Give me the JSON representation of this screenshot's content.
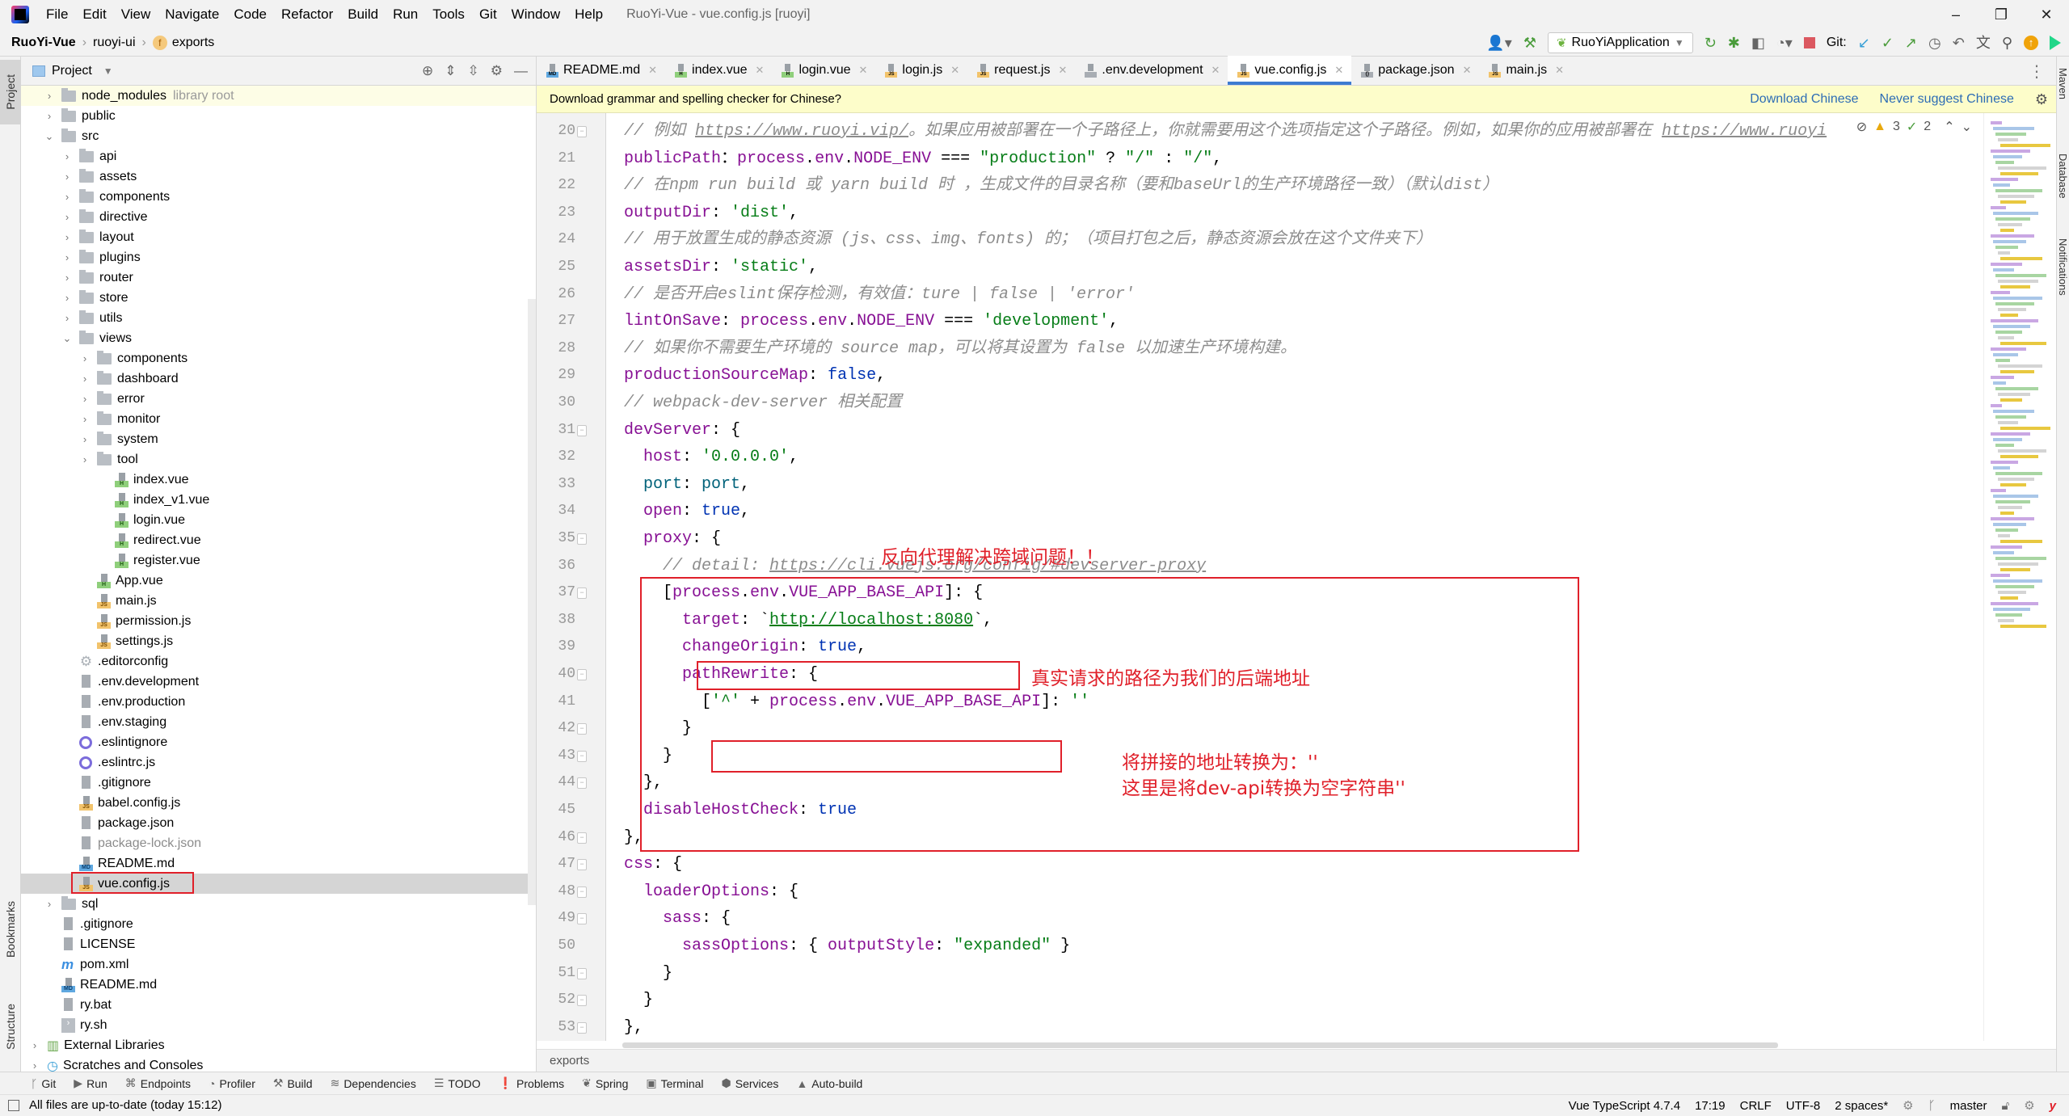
{
  "window": {
    "title": "RuoYi-Vue - vue.config.js [ruoyi]",
    "menu": [
      "File",
      "Edit",
      "View",
      "Navigate",
      "Code",
      "Refactor",
      "Build",
      "Run",
      "Tools",
      "Git",
      "Window",
      "Help"
    ],
    "controls": {
      "minimize": "–",
      "restore": "❐",
      "close": "✕"
    }
  },
  "breadcrumb": {
    "project": "RuoYi-Vue",
    "module": "ruoyi-ui",
    "symbol_badge": "f",
    "symbol": "exports"
  },
  "toolbar": {
    "run_config": "RuoYiApplication",
    "git_label": "Git:",
    "icons": [
      "user-icon",
      "build-hammer-icon",
      "rerun-icon",
      "debug-icon",
      "coverage-icon",
      "profile-icon",
      "stop-icon",
      "git-update-icon",
      "git-commit-icon",
      "git-push-icon",
      "history-icon",
      "rollback-icon",
      "translate-icon",
      "search-icon",
      "update-icon",
      "plugin-icon"
    ]
  },
  "colors": {
    "accent": "#3d7bd1",
    "annotation_red": "#e0202a",
    "keyword": "#871094",
    "string": "#067d17",
    "literal": "#0033b3",
    "comment": "#8c8c8c",
    "notice_bg": "#fdfdca"
  },
  "left_strip": {
    "project": "Project",
    "bookmarks": "Bookmarks",
    "structure": "Structure"
  },
  "right_strip": {
    "maven": "Maven",
    "database": "Database",
    "notifications": "Notifications"
  },
  "project_panel": {
    "title": "Project",
    "tree": [
      {
        "label": "node_modules",
        "suffix": "library root",
        "type": "folder",
        "depth": 2,
        "arrow": "›",
        "libroot": true
      },
      {
        "label": "public",
        "type": "folder",
        "depth": 2,
        "arrow": "›"
      },
      {
        "label": "src",
        "type": "folder",
        "depth": 2,
        "arrow": "⌄"
      },
      {
        "label": "api",
        "type": "folder",
        "depth": 3,
        "arrow": "›"
      },
      {
        "label": "assets",
        "type": "folder",
        "depth": 3,
        "arrow": "›"
      },
      {
        "label": "components",
        "type": "folder",
        "depth": 3,
        "arrow": "›"
      },
      {
        "label": "directive",
        "type": "folder",
        "depth": 3,
        "arrow": "›"
      },
      {
        "label": "layout",
        "type": "folder",
        "depth": 3,
        "arrow": "›"
      },
      {
        "label": "plugins",
        "type": "folder",
        "depth": 3,
        "arrow": "›"
      },
      {
        "label": "router",
        "type": "folder",
        "depth": 3,
        "arrow": "›"
      },
      {
        "label": "store",
        "type": "folder",
        "depth": 3,
        "arrow": "›"
      },
      {
        "label": "utils",
        "type": "folder",
        "depth": 3,
        "arrow": "›"
      },
      {
        "label": "views",
        "type": "folder",
        "depth": 3,
        "arrow": "⌄"
      },
      {
        "label": "components",
        "type": "folder",
        "depth": 4,
        "arrow": "›"
      },
      {
        "label": "dashboard",
        "type": "folder",
        "depth": 4,
        "arrow": "›"
      },
      {
        "label": "error",
        "type": "folder",
        "depth": 4,
        "arrow": "›"
      },
      {
        "label": "monitor",
        "type": "folder",
        "depth": 4,
        "arrow": "›"
      },
      {
        "label": "system",
        "type": "folder",
        "depth": 4,
        "arrow": "›"
      },
      {
        "label": "tool",
        "type": "folder",
        "depth": 4,
        "arrow": "›"
      },
      {
        "label": "index.vue",
        "type": "vue",
        "depth": 5
      },
      {
        "label": "index_v1.vue",
        "type": "vue",
        "depth": 5
      },
      {
        "label": "login.vue",
        "type": "vue",
        "depth": 5
      },
      {
        "label": "redirect.vue",
        "type": "vue",
        "depth": 5
      },
      {
        "label": "register.vue",
        "type": "vue",
        "depth": 5
      },
      {
        "label": "App.vue",
        "type": "vue",
        "depth": 4
      },
      {
        "label": "main.js",
        "type": "js",
        "depth": 4
      },
      {
        "label": "permission.js",
        "type": "js",
        "depth": 4
      },
      {
        "label": "settings.js",
        "type": "js",
        "depth": 4
      },
      {
        "label": ".editorconfig",
        "type": "gear",
        "depth": 3
      },
      {
        "label": ".env.development",
        "type": "txt",
        "depth": 3
      },
      {
        "label": ".env.production",
        "type": "txt",
        "depth": 3
      },
      {
        "label": ".env.staging",
        "type": "txt",
        "depth": 3
      },
      {
        "label": ".eslintignore",
        "type": "eslint",
        "depth": 3
      },
      {
        "label": ".eslintrc.js",
        "type": "eslint",
        "depth": 3
      },
      {
        "label": ".gitignore",
        "type": "ignore",
        "depth": 3
      },
      {
        "label": "babel.config.js",
        "type": "js",
        "depth": 3
      },
      {
        "label": "package.json",
        "type": "json",
        "depth": 3
      },
      {
        "label": "package-lock.json",
        "type": "json",
        "depth": 3,
        "dim": true
      },
      {
        "label": "README.md",
        "type": "md",
        "depth": 3
      },
      {
        "label": "vue.config.js",
        "type": "js",
        "depth": 3,
        "selected": true
      },
      {
        "label": "sql",
        "type": "folder",
        "depth": 2,
        "arrow": "›"
      },
      {
        "label": ".gitignore",
        "type": "ignore",
        "depth": 2
      },
      {
        "label": "LICENSE",
        "type": "txt",
        "depth": 2
      },
      {
        "label": "pom.xml",
        "type": "maven",
        "depth": 2
      },
      {
        "label": "README.md",
        "type": "md",
        "depth": 2
      },
      {
        "label": "ry.bat",
        "type": "bat",
        "depth": 2
      },
      {
        "label": "ry.sh",
        "type": "sh",
        "depth": 2
      },
      {
        "label": "External Libraries",
        "type": "libs",
        "depth": 1,
        "arrow": "›"
      },
      {
        "label": "Scratches and Consoles",
        "type": "scratch",
        "depth": 1,
        "arrow": "›"
      }
    ]
  },
  "editor": {
    "tabs": [
      {
        "label": "README.md",
        "type": "md"
      },
      {
        "label": "index.vue",
        "type": "vue"
      },
      {
        "label": "login.vue",
        "type": "vue"
      },
      {
        "label": "login.js",
        "type": "js"
      },
      {
        "label": "request.js",
        "type": "js"
      },
      {
        "label": ".env.development",
        "type": "txt"
      },
      {
        "label": "vue.config.js",
        "type": "js",
        "active": true
      },
      {
        "label": "package.json",
        "type": "json"
      },
      {
        "label": "main.js",
        "type": "js"
      }
    ],
    "notice": {
      "text": "Download grammar and spelling checker for Chinese?",
      "download": "Download Chinese",
      "never": "Never suggest Chinese"
    },
    "inspections": {
      "warnings": "3",
      "weak_warnings": "2"
    },
    "lines": [
      {
        "n": "20",
        "indent": 0,
        "tokens": [
          [
            "cm",
            "// 例如 "
          ],
          [
            "cm lnk",
            "https://www.ruoyi.vip/"
          ],
          [
            "cm",
            "。如果应用被部署在一个子路径上，你就需要用这个选项指定这个子路径。例如，如果你的应用被部署在 "
          ],
          [
            "cm lnk",
            "https://www.ruoyi"
          ]
        ]
      },
      {
        "n": "21",
        "indent": 0,
        "tokens": [
          [
            "kw",
            "publicPath"
          ],
          [
            "",
            "："
          ],
          [
            "kw",
            "process"
          ],
          [
            "",
            "."
          ],
          [
            "kw",
            "env"
          ],
          [
            "",
            "."
          ],
          [
            "kw",
            "NODE_ENV"
          ],
          [
            "",
            " === "
          ],
          [
            "str",
            "\"production\""
          ],
          [
            "",
            " ? "
          ],
          [
            "str",
            "\"/\""
          ],
          [
            "",
            " : "
          ],
          [
            "str",
            "\"/\""
          ],
          [
            "",
            ","
          ]
        ]
      },
      {
        "n": "22",
        "indent": 0,
        "tokens": [
          [
            "cm",
            "// 在npm run build 或 yarn build 时 ，生成文件的目录名称（要和baseUrl的生产环境路径一致）（默认dist）"
          ]
        ]
      },
      {
        "n": "23",
        "indent": 0,
        "tokens": [
          [
            "kw",
            "outputDir"
          ],
          [
            "",
            ": "
          ],
          [
            "str",
            "'dist'"
          ],
          [
            "",
            ","
          ]
        ]
      },
      {
        "n": "24",
        "indent": 0,
        "tokens": [
          [
            "cm",
            "// 用于放置生成的静态资源 (js、css、img、fonts) 的；（项目打包之后，静态资源会放在这个文件夹下）"
          ]
        ]
      },
      {
        "n": "25",
        "indent": 0,
        "tokens": [
          [
            "kw",
            "assetsDir"
          ],
          [
            "",
            ": "
          ],
          [
            "str",
            "'static'"
          ],
          [
            "",
            ","
          ]
        ]
      },
      {
        "n": "26",
        "indent": 0,
        "tokens": [
          [
            "cm",
            "// 是否开启eslint保存检测，有效值：ture | false | 'error'"
          ]
        ]
      },
      {
        "n": "27",
        "indent": 0,
        "tokens": [
          [
            "kw",
            "lintOnSave"
          ],
          [
            "",
            ": "
          ],
          [
            "kw",
            "process"
          ],
          [
            "",
            "."
          ],
          [
            "kw",
            "env"
          ],
          [
            "",
            "."
          ],
          [
            "kw",
            "NODE_ENV"
          ],
          [
            "",
            " === "
          ],
          [
            "str",
            "'development'"
          ],
          [
            "",
            ","
          ]
        ]
      },
      {
        "n": "28",
        "indent": 0,
        "tokens": [
          [
            "cm",
            "// 如果你不需要生产环境的 source map，可以将其设置为 false 以加速生产环境构建。"
          ]
        ]
      },
      {
        "n": "29",
        "indent": 0,
        "tokens": [
          [
            "kw",
            "productionSourceMap"
          ],
          [
            "",
            ": "
          ],
          [
            "kw2",
            "false"
          ],
          [
            "",
            ","
          ]
        ]
      },
      {
        "n": "30",
        "indent": 0,
        "tokens": [
          [
            "cm",
            "// webpack-dev-server 相关配置"
          ]
        ]
      },
      {
        "n": "31",
        "indent": 0,
        "tokens": [
          [
            "kw",
            "devServer"
          ],
          [
            "",
            ": {"
          ]
        ]
      },
      {
        "n": "32",
        "indent": 1,
        "tokens": [
          [
            "kw",
            "host"
          ],
          [
            "",
            ": "
          ],
          [
            "str",
            "'0.0.0.0'"
          ],
          [
            "",
            ","
          ]
        ]
      },
      {
        "n": "33",
        "indent": 1,
        "tokens": [
          [
            "tl",
            "port"
          ],
          [
            "",
            ": "
          ],
          [
            "tl",
            "port"
          ],
          [
            "",
            ","
          ]
        ]
      },
      {
        "n": "34",
        "indent": 1,
        "tokens": [
          [
            "kw",
            "open"
          ],
          [
            "",
            ": "
          ],
          [
            "kw2",
            "true"
          ],
          [
            "",
            ","
          ]
        ]
      },
      {
        "n": "35",
        "indent": 1,
        "tokens": [
          [
            "kw",
            "proxy"
          ],
          [
            "",
            ": {"
          ]
        ]
      },
      {
        "n": "36",
        "indent": 2,
        "tokens": [
          [
            "cm",
            "// detail: "
          ],
          [
            "cm lnk",
            "https://cli.vuejs.org/config/#devserver-proxy"
          ]
        ]
      },
      {
        "n": "37",
        "indent": 2,
        "tokens": [
          [
            "",
            "["
          ],
          [
            "kw",
            "process"
          ],
          [
            "",
            "."
          ],
          [
            "kw",
            "env"
          ],
          [
            "",
            "."
          ],
          [
            "kw",
            "VUE_APP_BASE_API"
          ],
          [
            "",
            "]: {"
          ]
        ]
      },
      {
        "n": "38",
        "indent": 3,
        "tokens": [
          [
            "kw",
            "target"
          ],
          [
            "",
            ": `"
          ],
          [
            "str lnk",
            "http://localhost:8080"
          ],
          [
            "",
            "`,"
          ]
        ]
      },
      {
        "n": "39",
        "indent": 3,
        "tokens": [
          [
            "kw",
            "changeOrigin"
          ],
          [
            "",
            ": "
          ],
          [
            "kw2",
            "true"
          ],
          [
            "",
            ","
          ]
        ]
      },
      {
        "n": "40",
        "indent": 3,
        "tokens": [
          [
            "kw",
            "pathRewrite"
          ],
          [
            "",
            ": {"
          ]
        ]
      },
      {
        "n": "41",
        "indent": 4,
        "tokens": [
          [
            "",
            "["
          ],
          [
            "str",
            "'^'"
          ],
          [
            "",
            " + "
          ],
          [
            "kw",
            "process"
          ],
          [
            "",
            "."
          ],
          [
            "kw",
            "env"
          ],
          [
            "",
            "."
          ],
          [
            "kw",
            "VUE_APP_BASE_API"
          ],
          [
            "",
            "]: "
          ],
          [
            "str",
            "''"
          ]
        ]
      },
      {
        "n": "42",
        "indent": 3,
        "tokens": [
          [
            "",
            "}"
          ]
        ]
      },
      {
        "n": "43",
        "indent": 2,
        "tokens": [
          [
            "",
            "}"
          ]
        ]
      },
      {
        "n": "44",
        "indent": 1,
        "tokens": [
          [
            "",
            "},"
          ]
        ]
      },
      {
        "n": "45",
        "indent": 1,
        "tokens": [
          [
            "kw",
            "disableHostCheck"
          ],
          [
            "",
            ": "
          ],
          [
            "kw2",
            "true"
          ]
        ]
      },
      {
        "n": "46",
        "indent": 0,
        "tokens": [
          [
            "",
            "},"
          ]
        ]
      },
      {
        "n": "47",
        "indent": 0,
        "tokens": [
          [
            "kw",
            "css"
          ],
          [
            "",
            ": {"
          ]
        ]
      },
      {
        "n": "48",
        "indent": 1,
        "tokens": [
          [
            "kw",
            "loaderOptions"
          ],
          [
            "",
            ": {"
          ]
        ]
      },
      {
        "n": "49",
        "indent": 2,
        "tokens": [
          [
            "kw",
            "sass"
          ],
          [
            "",
            ": {"
          ]
        ]
      },
      {
        "n": "50",
        "indent": 3,
        "tokens": [
          [
            "kw",
            "sassOptions"
          ],
          [
            "",
            ": { "
          ],
          [
            "kw",
            "outputStyle"
          ],
          [
            "",
            ": "
          ],
          [
            "str",
            "\"expanded\""
          ],
          [
            "",
            " }"
          ]
        ]
      },
      {
        "n": "51",
        "indent": 2,
        "tokens": [
          [
            "",
            "}"
          ]
        ]
      },
      {
        "n": "52",
        "indent": 1,
        "tokens": [
          [
            "",
            "}"
          ]
        ]
      },
      {
        "n": "53",
        "indent": 0,
        "tokens": [
          [
            "",
            "},"
          ]
        ]
      }
    ],
    "annotations": {
      "proxy_title": "反向代理解决跨域问题！！",
      "target_note": "真实请求的路径为我们的后端地址",
      "rewrite_note_1": "将拼接的地址转换为：''",
      "rewrite_note_2": "这里是将dev-api转换为空字符串''"
    },
    "bottom_breadcrumb": "exports"
  },
  "tool_windows": [
    {
      "label": "Git",
      "icon": "git-branch-icon",
      "glyph": "ᚴ"
    },
    {
      "label": "Run",
      "icon": "run-icon",
      "glyph": "▶"
    },
    {
      "label": "Endpoints",
      "icon": "endpoints-icon",
      "glyph": "⌘"
    },
    {
      "label": "Profiler",
      "icon": "profiler-icon",
      "glyph": "◔"
    },
    {
      "label": "Build",
      "icon": "build-icon",
      "glyph": "⚒"
    },
    {
      "label": "Dependencies",
      "icon": "dependencies-icon",
      "glyph": "≋"
    },
    {
      "label": "TODO",
      "icon": "todo-icon",
      "glyph": "☰"
    },
    {
      "label": "Problems",
      "icon": "problems-icon",
      "glyph": "❗"
    },
    {
      "label": "Spring",
      "icon": "spring-icon",
      "glyph": "❦"
    },
    {
      "label": "Terminal",
      "icon": "terminal-icon",
      "glyph": "▣"
    },
    {
      "label": "Services",
      "icon": "services-icon",
      "glyph": "⬢"
    },
    {
      "label": "Auto-build",
      "icon": "auto-build-icon",
      "glyph": "▲"
    }
  ],
  "status_bar": {
    "message": "All files are up-to-date (today 15:12)",
    "language": "Vue TypeScript 4.7.4",
    "position": "17:19",
    "line_ending": "CRLF",
    "encoding": "UTF-8",
    "indent": "2 spaces*",
    "branch": "master"
  }
}
